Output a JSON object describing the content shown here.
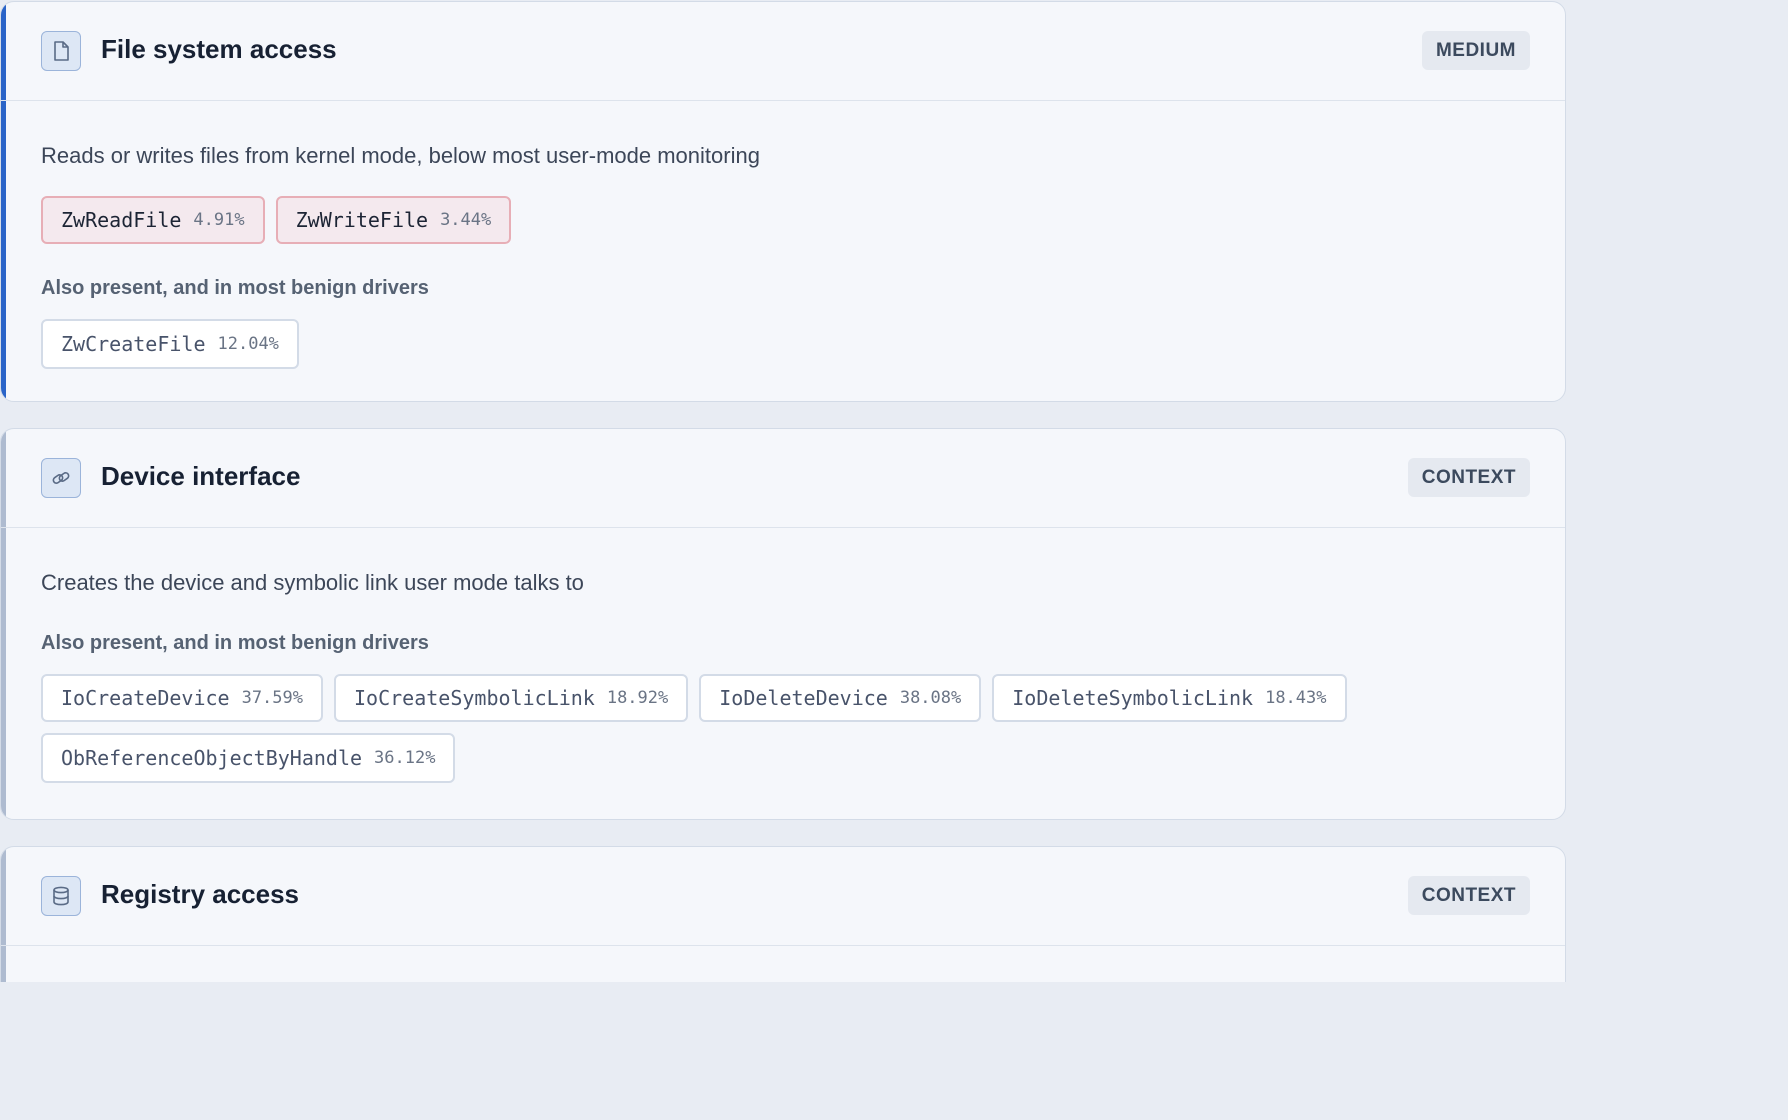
{
  "cards": [
    {
      "title": "File system access",
      "badge": "MEDIUM",
      "icon": "file-icon",
      "description": "Reads or writes files from kernel mode, below most user-mode monitoring",
      "flagged": [
        {
          "name": "ZwReadFile",
          "pct": "4.91%"
        },
        {
          "name": "ZwWriteFile",
          "pct": "3.44%"
        }
      ],
      "benign_heading": "Also present, and in most benign drivers",
      "benign": [
        {
          "name": "ZwCreateFile",
          "pct": "12.04%"
        }
      ]
    },
    {
      "title": "Device interface",
      "badge": "CONTEXT",
      "icon": "link-icon",
      "description": "Creates the device and symbolic link user mode talks to",
      "benign_heading": "Also present, and in most benign drivers",
      "benign": [
        {
          "name": "IoCreateDevice",
          "pct": "37.59%"
        },
        {
          "name": "IoCreateSymbolicLink",
          "pct": "18.92%"
        },
        {
          "name": "IoDeleteDevice",
          "pct": "38.08%"
        },
        {
          "name": "IoDeleteSymbolicLink",
          "pct": "18.43%"
        },
        {
          "name": "ObReferenceObjectByHandle",
          "pct": "36.12%"
        }
      ]
    },
    {
      "title": "Registry access",
      "badge": "CONTEXT",
      "icon": "database-icon"
    }
  ],
  "colors": {
    "accent_medium": "#2a64c8",
    "accent_context": "#aebbd0",
    "flagged_chip_bg": "#f4e9ee",
    "flagged_chip_border": "#e7aeb6"
  }
}
